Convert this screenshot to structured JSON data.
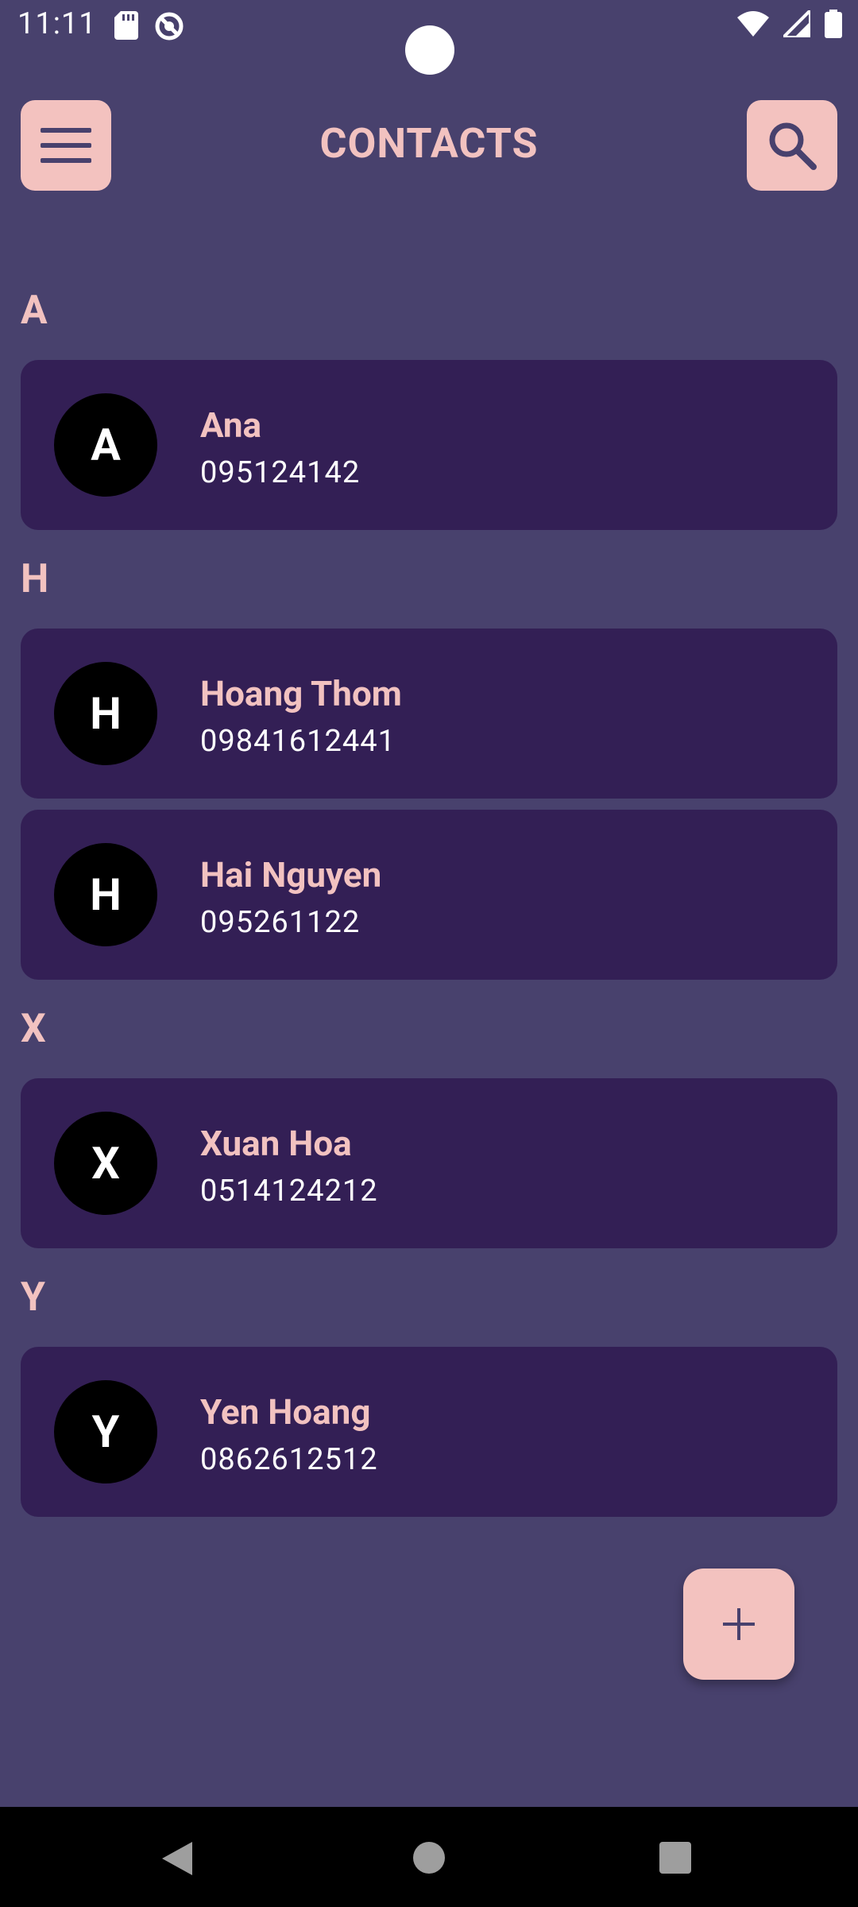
{
  "status_bar": {
    "time": "11:11"
  },
  "app_bar": {
    "title": "CONTACTS"
  },
  "sections": [
    {
      "letter": "A",
      "contacts": [
        {
          "initial": "A",
          "name": "Ana",
          "phone": "095124142"
        }
      ]
    },
    {
      "letter": "H",
      "contacts": [
        {
          "initial": "H",
          "name": "Hoang Thom",
          "phone": "09841612441"
        },
        {
          "initial": "H",
          "name": "Hai Nguyen",
          "phone": "095261122"
        }
      ]
    },
    {
      "letter": "X",
      "contacts": [
        {
          "initial": "X",
          "name": "Xuan Hoa",
          "phone": "0514124212"
        }
      ]
    },
    {
      "letter": "Y",
      "contacts": [
        {
          "initial": "Y",
          "name": "Yen Hoang",
          "phone": "0862612512"
        }
      ]
    }
  ],
  "icons": {
    "menu": "menu-icon",
    "search": "search-icon",
    "add": "plus-icon",
    "back": "back-icon",
    "home": "home-icon",
    "recent": "recent-apps-icon"
  },
  "colors": {
    "background": "#48416d",
    "card": "#331f55",
    "accent": "#f3c2bf",
    "avatar": "#000000",
    "nav_bar": "#000000"
  }
}
